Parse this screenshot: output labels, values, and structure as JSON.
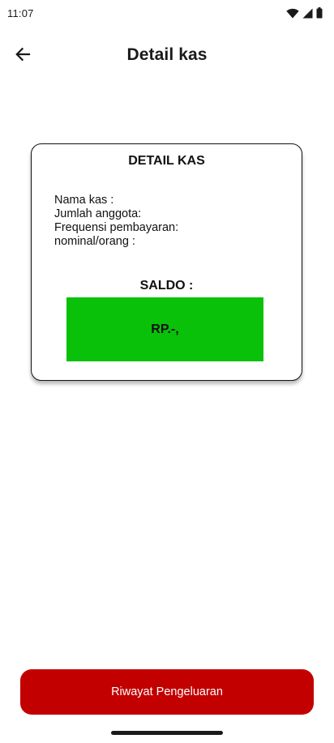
{
  "status_bar": {
    "time": "11:07",
    "icons": [
      "wifi-icon",
      "cellular-signal-icon",
      "battery-icon"
    ]
  },
  "app_bar": {
    "back_icon": "arrow-left-icon",
    "title": "Detail kas"
  },
  "card": {
    "title": "DETAIL KAS",
    "info_lines": [
      "Nama kas :",
      "Jumlah anggota:",
      "Frequensi pembayaran:",
      "nominal/orang :"
    ],
    "saldo_label": "SALDO :",
    "saldo_value": "RP.-,"
  },
  "history_button": {
    "label": "Riwayat Pengeluaran"
  },
  "colors": {
    "saldo_background": "#0ac10a",
    "button_background": "#c20000",
    "button_text": "#ffffff"
  }
}
